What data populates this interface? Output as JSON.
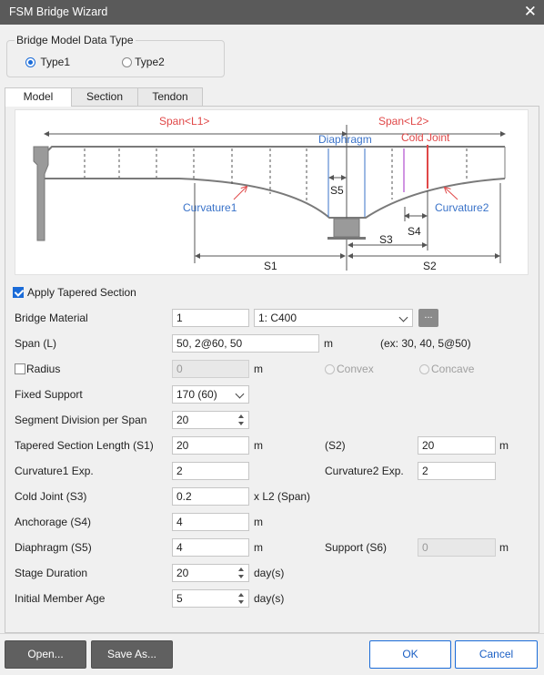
{
  "window": {
    "title": "FSM Bridge Wizard",
    "close_glyph": "✕"
  },
  "data_type": {
    "legend": "Bridge Model Data Type",
    "options": [
      {
        "label": "Type1",
        "selected": true
      },
      {
        "label": "Type2",
        "selected": false
      }
    ]
  },
  "tabs": [
    {
      "label": "Model",
      "active": true
    },
    {
      "label": "Section",
      "active": false
    },
    {
      "label": "Tendon",
      "active": false
    }
  ],
  "diagram": {
    "span_l1": "Span<L1>",
    "span_l2": "Span<L2>",
    "diaphragm": "Diaphragm",
    "cold_joint": "Cold Joint",
    "s5": "S5",
    "s4": "S4",
    "s3": "S3",
    "s1": "S1",
    "s2": "S2",
    "curvature1": "Curvature1",
    "curvature2": "Curvature2",
    "colors": {
      "red": "#e04848",
      "blue": "#3a73c9",
      "grey": "#7a7a7a",
      "purple": "#c070d8"
    }
  },
  "form": {
    "apply_tapered": {
      "label": "Apply Tapered Section",
      "checked": true
    },
    "bridge_material": {
      "label": "Bridge Material",
      "value": "1",
      "selected": "1: C400",
      "more_button": "..."
    },
    "span": {
      "label": "Span (L)",
      "value": "50, 2@60, 50",
      "unit": "m",
      "example": "(ex: 30, 40, 5@50)"
    },
    "radius": {
      "label": "Radius",
      "checked": false,
      "value": "0",
      "unit": "m",
      "convex": "Convex",
      "concave": "Concave"
    },
    "fixed_support": {
      "label": "Fixed Support",
      "selected": "170 (60)"
    },
    "segment_division": {
      "label": "Segment Division per Span",
      "value": "20"
    },
    "tapered_length": {
      "label": "Tapered Section Length (S1)",
      "value": "20",
      "unit": "m",
      "s2_label": "(S2)",
      "s2_value": "20",
      "s2_unit": "m"
    },
    "curvature": {
      "label": "Curvature1 Exp.",
      "value": "2",
      "label2": "Curvature2 Exp.",
      "value2": "2"
    },
    "cold_joint": {
      "label": "Cold Joint (S3)",
      "value": "0.2",
      "unit": "x L2 (Span)"
    },
    "anchorage": {
      "label": "Anchorage (S4)",
      "value": "4",
      "unit": "m"
    },
    "diaphragm": {
      "label": "Diaphragm (S5)",
      "value": "4",
      "unit": "m",
      "support_label": "Support (S6)",
      "support_value": "0",
      "support_unit": "m"
    },
    "stage_duration": {
      "label": "Stage Duration",
      "value": "20",
      "unit": "day(s)"
    },
    "initial_age": {
      "label": "Initial Member Age",
      "value": "5",
      "unit": "day(s)"
    }
  },
  "buttons": {
    "open": "Open...",
    "save_as": "Save As...",
    "ok": "OK",
    "cancel": "Cancel"
  }
}
